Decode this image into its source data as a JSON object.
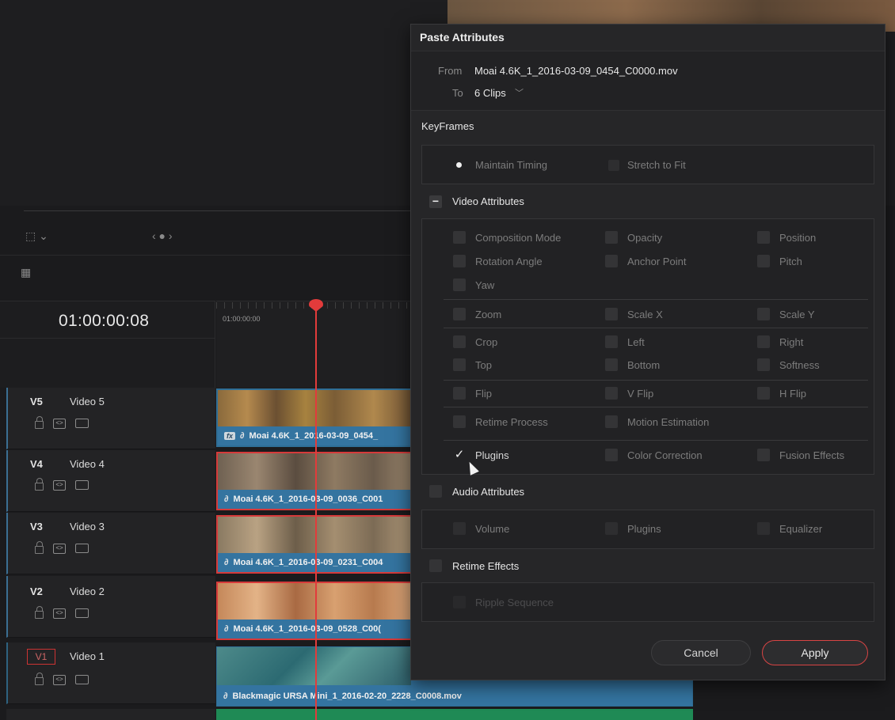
{
  "timeline": {
    "timecode": "01:00:00:08",
    "ruler_start": "01:00:00:00",
    "tracks": [
      {
        "id": "V5",
        "name": "Video 5",
        "clip": "Moai 4.6K_1_2016-03-09_0454_",
        "fx": "fx"
      },
      {
        "id": "V4",
        "name": "Video 4",
        "clip": "Moai 4.6K_1_2016-03-09_0036_C001"
      },
      {
        "id": "V3",
        "name": "Video 3",
        "clip": "Moai 4.6K_1_2016-03-09_0231_C004"
      },
      {
        "id": "V2",
        "name": "Video 2",
        "clip": "Moai 4.6K_1_2016-03-09_0528_C00("
      },
      {
        "id": "V1",
        "name": "Video 1",
        "clip": "Blackmagic URSA Mini_1_2016-02-20_2228_C0008.mov"
      }
    ]
  },
  "dialog": {
    "title": "Paste Attributes",
    "from_label": "From",
    "from_value": "Moai 4.6K_1_2016-03-09_0454_C0000.mov",
    "to_label": "To",
    "to_value": "6 Clips",
    "keyframes": {
      "title": "KeyFrames",
      "maintain_timing": "Maintain Timing",
      "stretch_to_fit": "Stretch to Fit"
    },
    "video": {
      "title": "Video Attributes",
      "options": {
        "composition_mode": "Composition Mode",
        "opacity": "Opacity",
        "position": "Position",
        "rotation_angle": "Rotation Angle",
        "anchor_point": "Anchor Point",
        "pitch": "Pitch",
        "yaw": "Yaw",
        "zoom": "Zoom",
        "scale_x": "Scale X",
        "scale_y": "Scale Y",
        "crop": "Crop",
        "left": "Left",
        "right": "Right",
        "top": "Top",
        "bottom": "Bottom",
        "softness": "Softness",
        "flip": "Flip",
        "v_flip": "V Flip",
        "h_flip": "H Flip",
        "retime_process": "Retime Process",
        "motion_estimation": "Motion Estimation",
        "plugins": "Plugins",
        "color_correction": "Color Correction",
        "fusion_effects": "Fusion Effects"
      }
    },
    "audio": {
      "title": "Audio Attributes",
      "volume": "Volume",
      "plugins": "Plugins",
      "equalizer": "Equalizer"
    },
    "retime": {
      "title": "Retime Effects",
      "ripple_sequence": "Ripple Sequence"
    },
    "cancel": "Cancel",
    "apply": "Apply"
  },
  "colors": {
    "accent_red": "#d84444",
    "clip_blue": "#3474a0",
    "clip_green": "#1f8a55"
  }
}
